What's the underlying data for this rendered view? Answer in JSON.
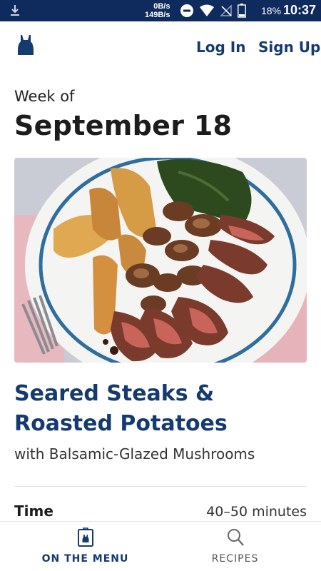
{
  "status_bar": {
    "speed_up": "0B/s",
    "speed_down": "149B/s",
    "battery_percent": "18%",
    "time": "10:37",
    "icons": [
      "download-icon",
      "do-not-disturb-icon",
      "wifi-icon",
      "no-signal-icon",
      "battery-icon"
    ]
  },
  "header": {
    "logo": "apron-logo-icon",
    "login_label": "Log In",
    "signup_label": "Sign Up"
  },
  "week": {
    "label": "Week of",
    "date": "September 18"
  },
  "recipe": {
    "title": "Seared Steaks & Roasted Potatoes",
    "subtitle": "with Balsamic-Glazed Mushrooms",
    "time_label": "Time",
    "time_value": "40–50 minutes"
  },
  "bottom_nav": {
    "items": [
      {
        "label": "ON THE MENU",
        "icon": "menu-card-icon",
        "active": true
      },
      {
        "label": "RECIPES",
        "icon": "search-icon",
        "active": false
      }
    ]
  },
  "colors": {
    "status_bar": "#0f2a5c",
    "brand_blue": "#143a6f"
  }
}
